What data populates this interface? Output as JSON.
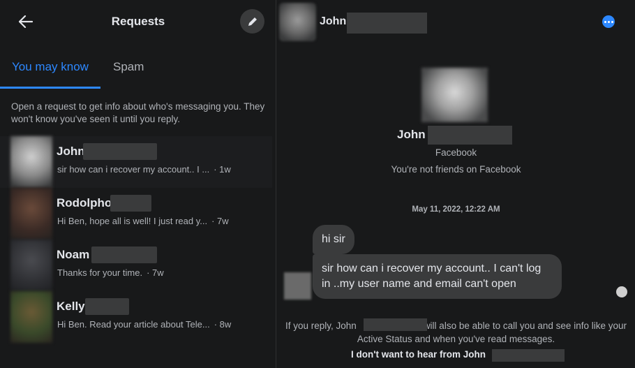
{
  "sidebar": {
    "title": "Requests",
    "tabs": [
      {
        "label": "You may know",
        "active": true
      },
      {
        "label": "Spam",
        "active": false
      }
    ],
    "info": "Open a request to get info about who's messaging you. They won't know you've seen it until you reply.",
    "requests": [
      {
        "name": "John",
        "preview": "sir how can i recover my account.. I ...",
        "time": "· 1w",
        "avatar_color": "#b5b5b5"
      },
      {
        "name": "Rodolpho",
        "preview": "Hi Ben, hope all is well! I just read y...",
        "time": "· 7w",
        "avatar_color": "#4a3a33"
      },
      {
        "name": "Noam",
        "preview": "Thanks for your time.",
        "time": "· 7w",
        "avatar_color": "#3a3b40"
      },
      {
        "name": "Kelly",
        "preview": "Hi Ben. Read your article about Tele...",
        "time": "· 8w",
        "avatar_color": "#5a4a2a"
      }
    ]
  },
  "conversation": {
    "header_name": "John",
    "profile_name": "John",
    "profile_platform": "Facebook",
    "profile_relation": "You're not friends on Facebook",
    "date": "May 11, 2022, 12:22 AM",
    "messages": [
      "hi sir",
      "sir how can i recover my account.. I can't log in ..my user name and email can't open"
    ],
    "footer_prefix": "If you reply, John",
    "footer_suffix": "will also be able to call you and see info like your Active Status and when you've read messages.",
    "block_label": "I don't want to hear from John"
  },
  "colors": {
    "accent": "#2d88ff",
    "background": "#18191a",
    "bubble": "#3a3b3c"
  }
}
